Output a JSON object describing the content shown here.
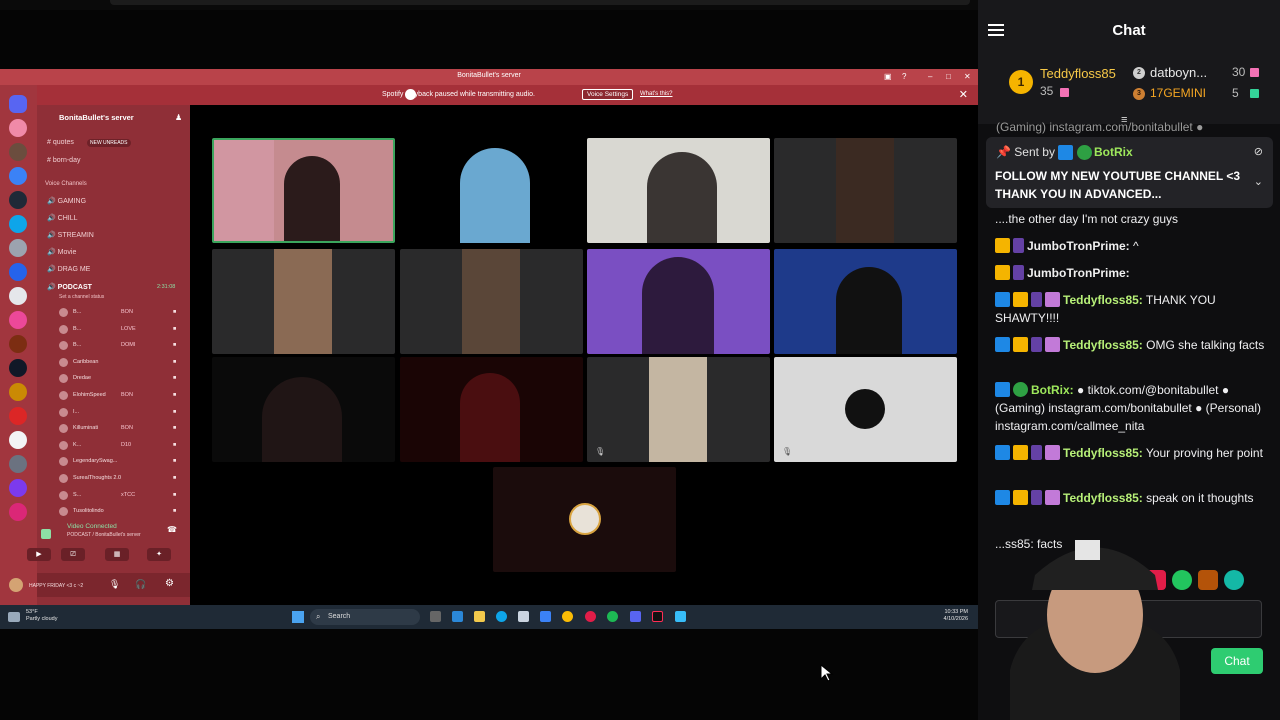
{
  "discord": {
    "title": "BonitaBullet's server",
    "notice": "Spotify playback paused while transmitting audio.",
    "notice_button": "Voice Settings",
    "notice_link": "What's this?",
    "server_name": "BonitaBullet's server",
    "text_channels": [
      "quotes",
      "born-day"
    ],
    "new_unreads": "NEW UNREADS",
    "voice_header": "Voice Channels",
    "voice_channels": [
      "GAMING",
      "CHILL",
      "STREAMIN",
      "Movie",
      "DRAG ME"
    ],
    "podcast": "PODCAST",
    "podcast_time": "2:31:08",
    "podcast_status": "Set a channel status",
    "users": [
      "B...",
      "B...",
      "B...",
      "Caribbean",
      "Dredae",
      "ElohimSpeed",
      "I...",
      "Killuminati",
      "K...",
      "LegendarySwag...",
      "SurealThoughts 2.0",
      "S...",
      "Tusolitolindo"
    ],
    "user_tags": [
      "BON",
      "LOVE",
      "DOMI",
      "",
      "",
      "BON",
      "",
      "BON",
      "D10",
      "",
      "",
      "xTCC",
      ""
    ],
    "video_connected": "Video Connected",
    "video_sub": "PODCAST / BonitaBullet's server",
    "self_status": "HAPPY FRIDAY <3 c ~2"
  },
  "taskbar": {
    "weather_temp": "53°F",
    "weather_desc": "Partly cloudy",
    "search": "Search",
    "time": "10:33 PM",
    "date": "4/10/2026"
  },
  "chat": {
    "title": "Chat",
    "leaderboard": [
      {
        "rank": "1",
        "name": "Teddyfloss85",
        "count": "35"
      },
      {
        "rank": "2",
        "name": "datboyn...",
        "count": "30"
      },
      {
        "rank": "3",
        "name": "17GEMINI",
        "count": "5"
      }
    ],
    "overflow_text": "(Gaming) instagram.com/bonitabullet ●",
    "pinned": {
      "sent_by": "Sent by",
      "author": "BotRix",
      "message": "FOLLOW MY NEW YOUTUBE CHANNEL <3 THANK YOU IN ADVANCED..."
    },
    "messages": [
      {
        "user": "",
        "text": "....the other day I'm not crazy guys",
        "color": "#efeff1"
      },
      {
        "user": "JumboTronPrime:",
        "text": " ^",
        "color": "#f0f0f0"
      },
      {
        "user": "JumboTronPrime:",
        "text": "",
        "color": "#f0f0f0"
      },
      {
        "user": "Teddyfloss85:",
        "text": " THANK YOU SHAWTY!!!!",
        "color": "#b7f078"
      },
      {
        "user": "Teddyfloss85:",
        "text": " OMG she talking facts",
        "color": "#b7f078"
      },
      {
        "user": "BotRix:",
        "text": " ● tiktok.com/@bonitabullet ● (Gaming) instagram.com/bonitabullet ● (Personal) instagram.com/callmee_nita",
        "color": "#9ee85c"
      },
      {
        "user": "Teddyfloss85:",
        "text": " Your proving her point",
        "color": "#b7f078"
      },
      {
        "user": "Teddyfloss85:",
        "text": " speak on it thoughts",
        "color": "#b7f078"
      },
      {
        "user": "",
        "text": "...ss85: facts",
        "color": "#efeff1"
      }
    ],
    "chat_button": "Chat"
  },
  "colors": {
    "discord_red": "#a1363e",
    "discord_panel": "#8f2f37",
    "chat_bg": "#0e0e10",
    "username_green": "#b7f078",
    "chat_button": "#2ecc71"
  }
}
